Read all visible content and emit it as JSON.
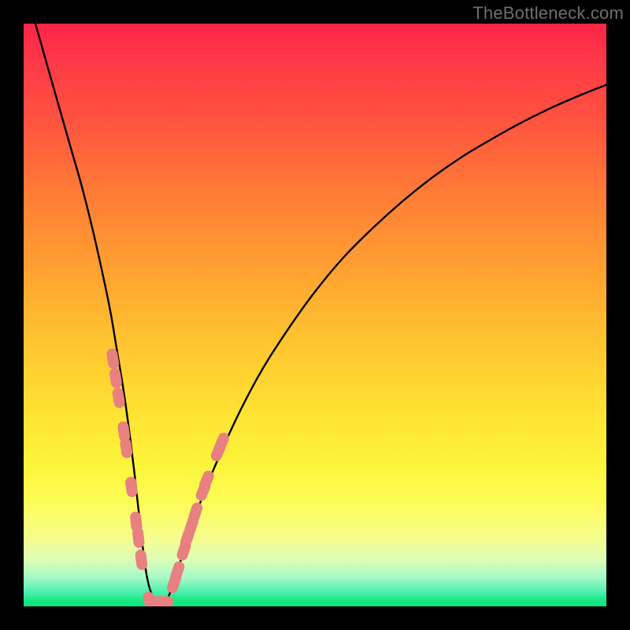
{
  "watermark": "TheBottleneck.com",
  "chart_data": {
    "type": "line",
    "title": "",
    "xlabel": "",
    "ylabel": "",
    "xlim": [
      0,
      100
    ],
    "ylim": [
      0,
      100
    ],
    "grid": false,
    "legend": false,
    "series": [
      {
        "name": "bottleneck-curve",
        "stroke": "#000000",
        "x": [
          0,
          2,
          4,
          6,
          8,
          10,
          12,
          14,
          15,
          16,
          17,
          18,
          19,
          20,
          21,
          22,
          23,
          24,
          25,
          27,
          30,
          35,
          40,
          45,
          50,
          55,
          60,
          65,
          70,
          75,
          80,
          85,
          90,
          95,
          100
        ],
        "y": [
          106,
          100,
          93,
          86,
          79,
          72,
          64,
          55,
          50,
          44,
          38,
          31,
          23,
          14,
          6,
          2,
          0.5,
          0.5,
          2,
          8,
          17,
          29,
          39,
          47,
          54,
          60,
          65,
          69.5,
          73.5,
          77,
          80,
          82.8,
          85.3,
          87.5,
          89.5
        ]
      }
    ],
    "markers": [
      {
        "name": "pink-markers",
        "fill": "#e88080",
        "points": [
          {
            "x": 15.3,
            "y": 42.5
          },
          {
            "x": 15.8,
            "y": 39.2
          },
          {
            "x": 16.3,
            "y": 35.8
          },
          {
            "x": 17.2,
            "y": 30.0
          },
          {
            "x": 17.6,
            "y": 27.2
          },
          {
            "x": 18.5,
            "y": 20.5
          },
          {
            "x": 19.3,
            "y": 14.5
          },
          {
            "x": 19.7,
            "y": 11.8
          },
          {
            "x": 20.2,
            "y": 8.0
          },
          {
            "x": 21.6,
            "y": 0.8
          },
          {
            "x": 22.4,
            "y": 0.4
          },
          {
            "x": 23.2,
            "y": 0.4
          },
          {
            "x": 24.0,
            "y": 0.8
          },
          {
            "x": 25.8,
            "y": 4.0
          },
          {
            "x": 26.4,
            "y": 6.0
          },
          {
            "x": 27.5,
            "y": 9.6
          },
          {
            "x": 28.1,
            "y": 11.8
          },
          {
            "x": 28.8,
            "y": 13.9
          },
          {
            "x": 29.5,
            "y": 16.1
          },
          {
            "x": 30.8,
            "y": 19.8
          },
          {
            "x": 31.4,
            "y": 21.6
          },
          {
            "x": 33.4,
            "y": 26.6
          },
          {
            "x": 34.0,
            "y": 28.1
          }
        ]
      }
    ]
  }
}
